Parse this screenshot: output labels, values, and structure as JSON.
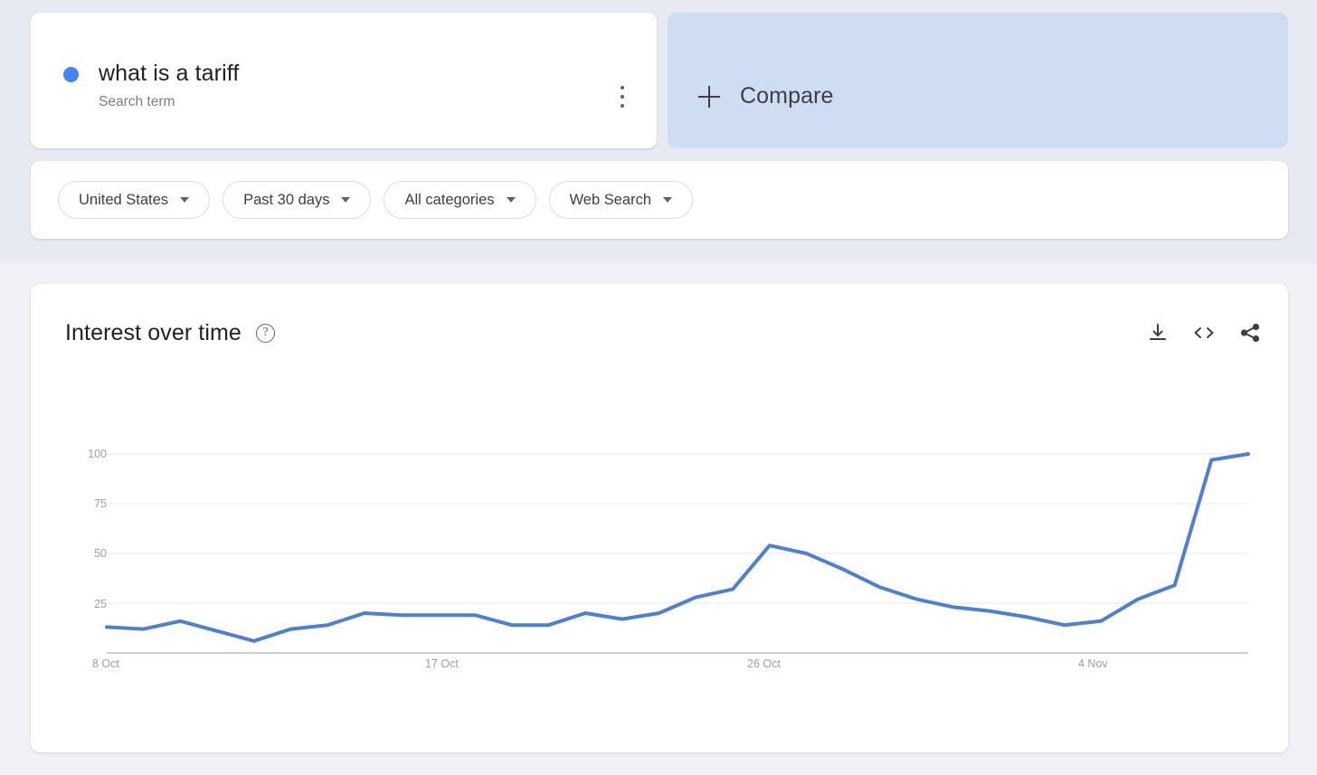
{
  "search_card": {
    "term": "what is a tariff",
    "subtitle": "Search term",
    "dot_color": "#4285f4",
    "menu_icon": "more-vert-icon"
  },
  "compare": {
    "label": "Compare",
    "icon": "plus-icon"
  },
  "filters": [
    {
      "label": "United States",
      "name": "region"
    },
    {
      "label": "Past 30 days",
      "name": "time-range"
    },
    {
      "label": "All categories",
      "name": "category"
    },
    {
      "label": "Web Search",
      "name": "search-type"
    }
  ],
  "chart_panel": {
    "title": "Interest over time",
    "help_icon": "help-circle-icon",
    "actions": [
      {
        "name": "download-icon",
        "label": "download"
      },
      {
        "name": "embed-code-icon",
        "label": "<>"
      },
      {
        "name": "share-icon",
        "label": "share"
      }
    ]
  },
  "chart_data": {
    "type": "line",
    "title": "Interest over time",
    "xlabel": "",
    "ylabel": "",
    "ylim": [
      0,
      100
    ],
    "yticks": [
      100,
      75,
      50,
      25
    ],
    "xticks": [
      "8 Oct",
      "17 Oct",
      "26 Oct",
      "4 Nov"
    ],
    "xtick_indices": [
      0,
      9,
      18,
      27
    ],
    "grid": true,
    "legend": "none",
    "line_color": "#4e7fd0",
    "series": [
      {
        "name": "what is a tariff",
        "x": [
          "8 Oct",
          "9 Oct",
          "10 Oct",
          "11 Oct",
          "12 Oct",
          "13 Oct",
          "14 Oct",
          "15 Oct",
          "16 Oct",
          "17 Oct",
          "18 Oct",
          "19 Oct",
          "20 Oct",
          "21 Oct",
          "22 Oct",
          "23 Oct",
          "24 Oct",
          "25 Oct",
          "26 Oct",
          "27 Oct",
          "28 Oct",
          "29 Oct",
          "30 Oct",
          "31 Oct",
          "1 Nov",
          "2 Nov",
          "3 Nov",
          "4 Nov",
          "5 Nov",
          "6 Nov",
          "7 Nov"
        ],
        "values": [
          13,
          12,
          16,
          11,
          6,
          12,
          14,
          20,
          19,
          19,
          19,
          14,
          14,
          20,
          17,
          20,
          28,
          32,
          54,
          50,
          42,
          33,
          27,
          23,
          21,
          18,
          14,
          16,
          27,
          34,
          97,
          100
        ]
      }
    ]
  }
}
